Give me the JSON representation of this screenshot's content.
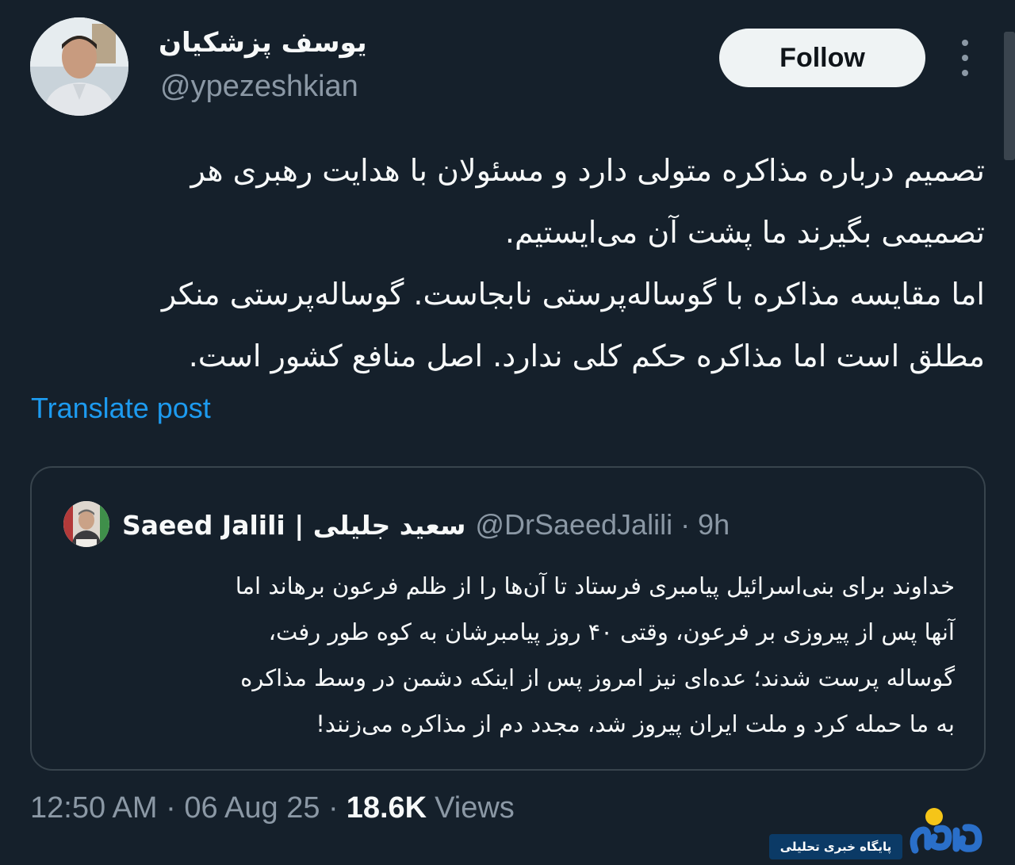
{
  "author": {
    "display_name": "یوسف پزشکیان",
    "handle": "@ypezeshkian"
  },
  "header": {
    "follow_label": "Follow"
  },
  "tweet": {
    "text": "تصمیم درباره مذاکره متولی دارد و مسئولان با هدایت رهبری هر\nتصمیمی بگیرند ما پشت آن می‌ایستیم.\nاما مقایسه مذاکره با گوساله‌پرستی نابجاست. گوساله‌پرستی منکر\nمطلق است اما مذاکره حکم کلی ندارد. اصل منافع کشور است.",
    "translate_label": "Translate post"
  },
  "quoted_tweet": {
    "name": "Saeed Jalili | سعید جلیلی",
    "meta": "@DrSaeedJalili · 9h",
    "text": "خداوند برای بنی‌اسرائیل پیامبری فرستاد تا آن‌ها را از ظلم فرعون برهاند اما\nآنها پس از پیروزی بر فرعون، وقتی ۴۰ روز پیامبرشان به کوه طور رفت،\nگوساله پرست شدند؛ عده‌ای نیز امروز پس از اینکه دشمن در وسط مذاکره\nبه ما حمله کرد و ملت ایران پیروز شد، مجدد دم از مذاکره می‌زنند!"
  },
  "footer": {
    "time_date": "12:50 AM · 06 Aug 25 ·",
    "views_count": "18.6K",
    "views_label": "Views"
  },
  "watermark": {
    "caption": "پایگاه خبری تحلیلی",
    "logo_text": "روزنو"
  },
  "colors": {
    "background": "#15202b",
    "text_primary": "#f7f9f9",
    "text_secondary": "#8b98a5",
    "link": "#1d9bf0",
    "border": "#38444d",
    "button_bg": "#eff3f4"
  },
  "icons": {
    "more": "more-vertical-icon"
  }
}
